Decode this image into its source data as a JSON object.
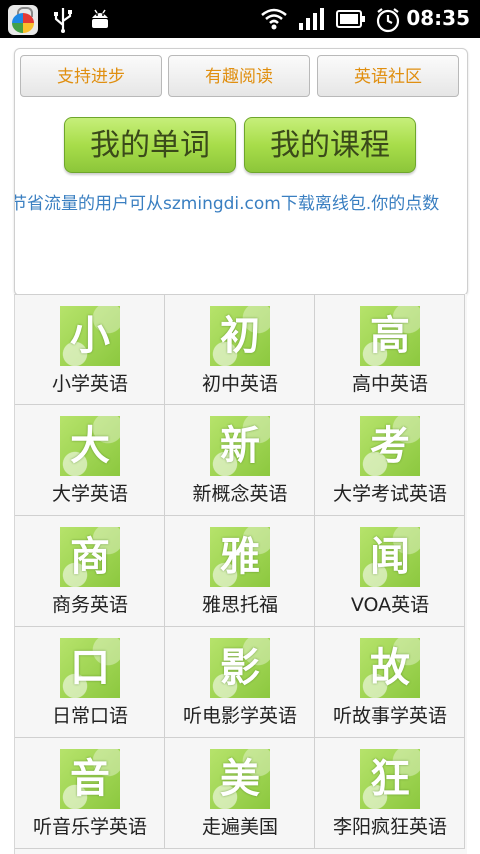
{
  "status_bar": {
    "time": "08:35"
  },
  "tabs": [
    "支持进步",
    "有趣阅读",
    "英语社区"
  ],
  "main_buttons": [
    "我的单词",
    "我的课程"
  ],
  "marquee_text": "需节省流量的用户可从szmingdi.com下载离线包.你的点数",
  "grid": [
    {
      "glyph": "小",
      "label": "小学英语"
    },
    {
      "glyph": "初",
      "label": "初中英语"
    },
    {
      "glyph": "高",
      "label": "高中英语"
    },
    {
      "glyph": "大",
      "label": "大学英语"
    },
    {
      "glyph": "新",
      "label": "新概念英语"
    },
    {
      "glyph": "考",
      "label": "大学考试英语"
    },
    {
      "glyph": "商",
      "label": "商务英语"
    },
    {
      "glyph": "雅",
      "label": "雅思托福"
    },
    {
      "glyph": "闻",
      "label": "VOA英语"
    },
    {
      "glyph": "口",
      "label": "日常口语"
    },
    {
      "glyph": "影",
      "label": "听电影学英语"
    },
    {
      "glyph": "故",
      "label": "听故事学英语"
    },
    {
      "glyph": "音",
      "label": "听音乐学英语"
    },
    {
      "glyph": "美",
      "label": "走遍美国"
    },
    {
      "glyph": "狂",
      "label": "李阳疯狂英语"
    }
  ]
}
